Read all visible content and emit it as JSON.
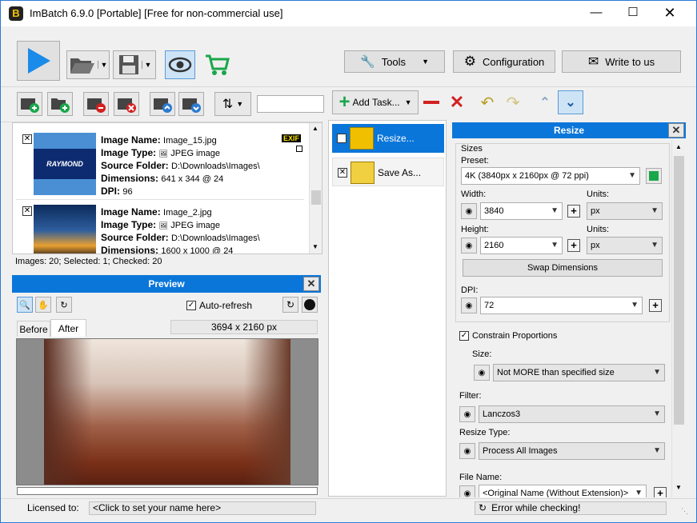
{
  "window": {
    "title": "ImBatch 6.9.0 [Portable] [Free for non-commercial use]",
    "logo": "B"
  },
  "toolbar": {
    "tools_label": "Tools",
    "configuration_label": "Configuration",
    "write_label": "Write to us"
  },
  "task_toolbar": {
    "add_task_label": "Add Task..."
  },
  "images": [
    {
      "name_label": "Image Name:",
      "name": "Image_15.jpg",
      "type_label": "Image Type:",
      "type": "JPEG image",
      "folder_label": "Source Folder:",
      "folder": "D:\\Downloads\\Images\\",
      "dims_label": "Dimensions:",
      "dims": "641 x 344 @ 24",
      "dpi_label": "DPI:",
      "dpi": "96",
      "badge": "EXIF",
      "thumb_text": "RAYMOND"
    },
    {
      "name_label": "Image Name:",
      "name": "Image_2.jpg",
      "type_label": "Image Type:",
      "type": "JPEG image",
      "folder_label": "Source Folder:",
      "folder": "D:\\Downloads\\Images\\",
      "dims_label": "Dimensions:",
      "dims": "1600 x 1000 @ 24"
    }
  ],
  "images_status": "Images: 20; Selected: 1; Checked: 20",
  "preview": {
    "title": "Preview",
    "autorefresh_label": "Auto-refresh",
    "tab_before": "Before",
    "tab_after": "After",
    "size": "3694 x 2160 px"
  },
  "tasks": [
    {
      "label": "Resize..."
    },
    {
      "label": "Save As..."
    }
  ],
  "resize": {
    "title": "Resize",
    "sizes_group": "Sizes",
    "preset_label": "Preset:",
    "preset_value": "4K (3840px x 2160px @ 72 ppi)",
    "width_label": "Width:",
    "width_value": "3840",
    "units_label": "Units:",
    "units_value": "px",
    "height_label": "Height:",
    "height_value": "2160",
    "units2_label": "Units:",
    "units2_value": "px",
    "swap_label": "Swap Dimensions",
    "dpi_label": "DPI:",
    "dpi_value": "72",
    "constrain_label": "Constrain Proportions",
    "size_label": "Size:",
    "size_value": "Not MORE than specified size",
    "filter_label": "Filter:",
    "filter_value": "Lanczos3",
    "resize_type_label": "Resize Type:",
    "resize_type_value": "Process All Images",
    "filename_label": "File Name:",
    "filename_value": "<Original Name (Without Extension)>"
  },
  "statusbar": {
    "licensed_label": "Licensed to:",
    "licensed_value": "<Click to set your name here>",
    "update_status": "Error while checking!"
  },
  "colors": {
    "accent": "#0b76d9",
    "title_bg": "#ffffff",
    "panel_bg": "#f0f0f0"
  }
}
